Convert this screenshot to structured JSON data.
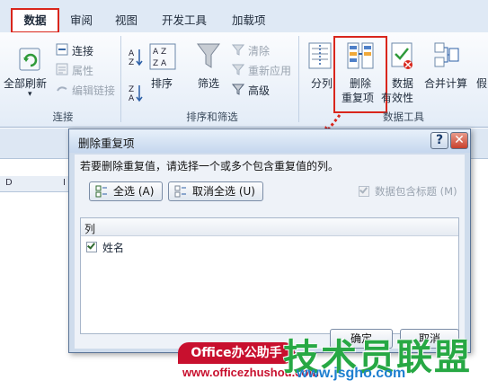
{
  "tabs": [
    "数据",
    "审阅",
    "视图",
    "开发工具",
    "加载项"
  ],
  "ribbon": {
    "refresh_all": "全部刷新",
    "connections": "连接",
    "properties": "属性",
    "edit_links": "编辑链接",
    "group_connections": "连接",
    "sort": "排序",
    "filter": "筛选",
    "clear": "清除",
    "reapply": "重新应用",
    "advanced": "高级",
    "group_sort_filter": "排序和筛选",
    "text_to_columns": "分列",
    "remove_duplicates_line1": "删除",
    "remove_duplicates_line2": "重复项",
    "data_validation_line1": "数据",
    "data_validation_line2": "有效性",
    "consolidate": "合并计算",
    "what_if": "假",
    "group_data_tools": "数据工具"
  },
  "sheet": {
    "col_a": "D",
    "col_b": "I"
  },
  "dialog": {
    "title": "删除重复项",
    "instruction": "若要删除重复值，请选择一个或多个包含重复值的列。",
    "select_all": "全选 (A)",
    "unselect_all": "取消全选 (U)",
    "has_headers": "数据包含标题 (M)",
    "help": "?",
    "close": "✕",
    "list_header": "列",
    "columns": [
      {
        "name": "姓名",
        "checked": true
      }
    ],
    "ok": "确定",
    "cancel": "取消"
  },
  "watermark": {
    "badge": "Office办公助手",
    "url": "www.officezhushou.com",
    "big": "技术员联盟",
    "site": "www.jsgho.com"
  },
  "colors": {
    "accent_red": "#d9261c",
    "ribbon_blue": "#dfe9f5"
  }
}
